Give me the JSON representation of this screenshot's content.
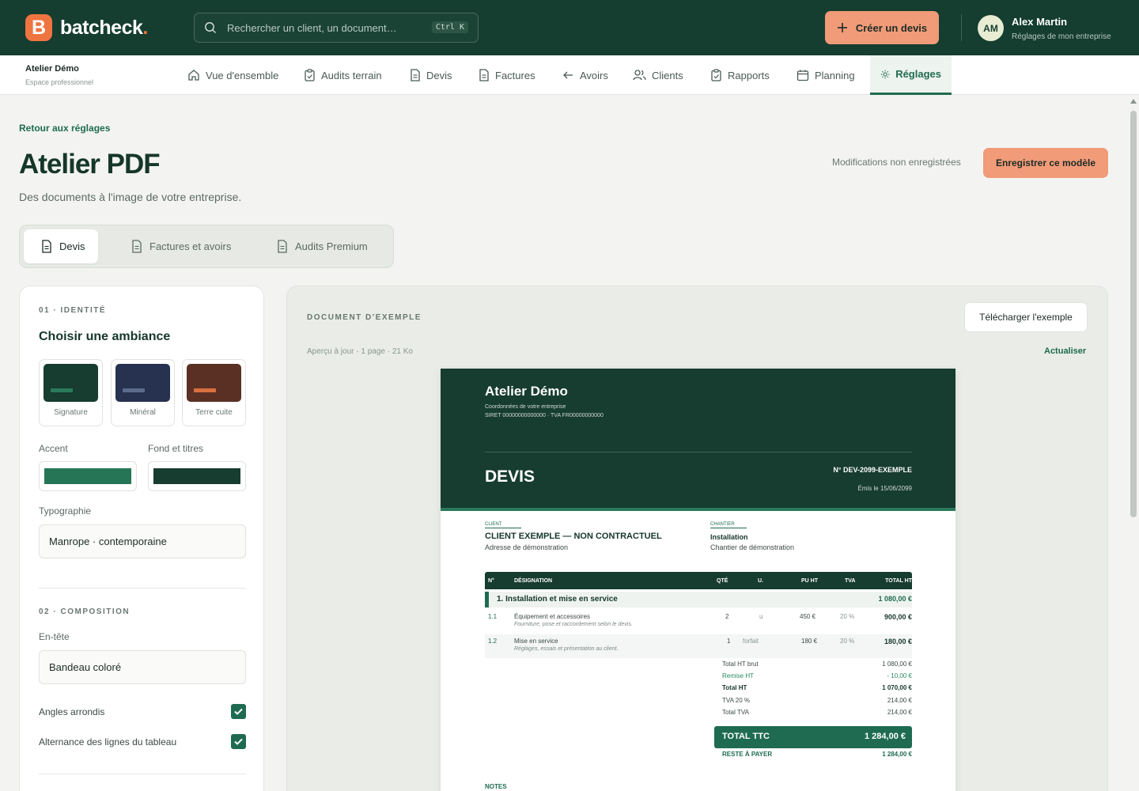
{
  "brand": {
    "logo_letter": "B",
    "name": "batcheck",
    "dot": ".",
    "accent": "#ee7440",
    "primary": "#153d30"
  },
  "search": {
    "placeholder": "Rechercher un client, un document…",
    "shortcut": "Ctrl K"
  },
  "header": {
    "create_label": "Créer un devis",
    "user_initials": "AM",
    "user_name": "Alex Martin",
    "user_sub": "Réglages de mon entreprise"
  },
  "org": {
    "name": "Atelier Démo",
    "sub": "Espace professionnel"
  },
  "nav": [
    {
      "label": "Vue d'ensemble",
      "icon": "home-icon"
    },
    {
      "label": "Audits terrain",
      "icon": "clipboard-icon"
    },
    {
      "label": "Devis",
      "icon": "document-icon"
    },
    {
      "label": "Factures",
      "icon": "document-icon"
    },
    {
      "label": "Avoirs",
      "icon": "arrow-left-icon"
    },
    {
      "label": "Clients",
      "icon": "users-icon"
    },
    {
      "label": "Rapports",
      "icon": "clipboard-icon"
    },
    {
      "label": "Planning",
      "icon": "calendar-icon"
    },
    {
      "label": "Réglages",
      "icon": "settings-icon",
      "active": true
    }
  ],
  "page": {
    "back": "Retour aux réglages",
    "title": "Atelier PDF",
    "subtitle": "Des documents à l'image de votre entreprise.",
    "unsaved": "Modifications non enregistrées",
    "save_label": "Enregistrer ce modèle"
  },
  "tabs": [
    {
      "label": "Devis",
      "active": true
    },
    {
      "label": "Factures et avoirs"
    },
    {
      "label": "Audits Premium"
    }
  ],
  "settings": {
    "sec1": "01 · IDENTITÉ",
    "ambiance_title": "Choisir une ambiance",
    "ambiances": [
      {
        "label": "Signature",
        "color": "#173c30",
        "bar": "#2a7a5c"
      },
      {
        "label": "Minéral",
        "color": "#26324f",
        "bar": "#5a6a8a"
      },
      {
        "label": "Terre cuite",
        "color": "#5a3025",
        "bar": "#d9703f"
      }
    ],
    "accent_label": "Accent",
    "accent_color": "#267556",
    "fond_label": "Fond et titres",
    "fond_color": "#173c30",
    "typo_label": "Typographie",
    "typo_value": "Manrope · contemporaine",
    "sec2": "02 · COMPOSITION",
    "header_label": "En-tête",
    "header_value": "Bandeau coloré",
    "check1": "Angles arrondis",
    "check2": "Alternance des lignes du tableau"
  },
  "preview": {
    "label": "DOCUMENT D'EXEMPLE",
    "meta": "Aperçu à jour · 1 page · 21 Ko",
    "download": "Télécharger l'exemple",
    "refresh": "Actualiser"
  },
  "document": {
    "company": "Atelier Démo",
    "coord": "Coordonnées de votre entreprise",
    "siret": "SIRET 00000000000000 · TVA FR00000000000",
    "title": "DEVIS",
    "number": "N° DEV-2099-EXEMPLE",
    "date": "Émis le 15/06/2099",
    "client_label": "CLIENT",
    "client_name": "CLIENT EXEMPLE — NON CONTRACTUEL",
    "client_addr": "Adresse de démonstration",
    "chantier_label": "CHANTIER",
    "chantier_name": "Installation",
    "chantier_addr": "Chantier de démonstration",
    "cols": {
      "n": "N°",
      "designation": "DÉSIGNATION",
      "qte": "QTÉ",
      "u": "U.",
      "pu": "PU HT",
      "tva": "TVA",
      "total": "TOTAL HT"
    },
    "section": {
      "title": "1.  Installation et mise en service",
      "total": "1 080,00 €"
    },
    "rows": [
      {
        "n": "1.1",
        "label": "Équipement et accessoires",
        "desc": "Fourniture, pose et raccordement selon le devis.",
        "qte": "2",
        "u": "u",
        "pu": "450 €",
        "tva": "20 %",
        "total": "900,00 €"
      },
      {
        "n": "1.2",
        "label": "Mise en service",
        "desc": "Réglages, essais et présentation au client.",
        "qte": "1",
        "u": "forfait",
        "pu": "180 €",
        "tva": "20 %",
        "total": "180,00 €"
      }
    ],
    "sums": [
      {
        "label": "Total HT brut",
        "value": "1 080,00 €"
      },
      {
        "label": "Remise HT",
        "value": "- 10,00 €"
      },
      {
        "label": "Total HT",
        "value": "1 070,00 €"
      },
      {
        "label": "TVA 20 %",
        "value": "214,00 €"
      },
      {
        "label": "Total TVA",
        "value": "214,00 €"
      }
    ],
    "ttc_label": "TOTAL TTC",
    "ttc_value": "1 284,00 €",
    "rest_label": "RESTE À PAYER",
    "rest_value": "1 284,00 €",
    "notes": "NOTES"
  }
}
